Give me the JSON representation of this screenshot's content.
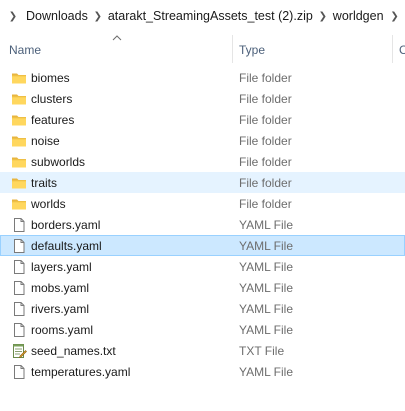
{
  "breadcrumb": {
    "items": [
      "Downloads",
      "atarakt_StreamingAssets_test (2).zip",
      "worldgen"
    ]
  },
  "columns": {
    "name": "Name",
    "type": "Type",
    "next": "C"
  },
  "files": [
    {
      "name": "biomes",
      "type": "File folder",
      "icon": "folder-icon",
      "state": "normal"
    },
    {
      "name": "clusters",
      "type": "File folder",
      "icon": "folder-icon",
      "state": "normal"
    },
    {
      "name": "features",
      "type": "File folder",
      "icon": "folder-icon",
      "state": "normal"
    },
    {
      "name": "noise",
      "type": "File folder",
      "icon": "folder-icon",
      "state": "normal"
    },
    {
      "name": "subworlds",
      "type": "File folder",
      "icon": "folder-icon",
      "state": "normal"
    },
    {
      "name": "traits",
      "type": "File folder",
      "icon": "folder-icon",
      "state": "hover"
    },
    {
      "name": "worlds",
      "type": "File folder",
      "icon": "folder-icon",
      "state": "normal"
    },
    {
      "name": "borders.yaml",
      "type": "YAML File",
      "icon": "document-icon",
      "state": "normal"
    },
    {
      "name": "defaults.yaml",
      "type": "YAML File",
      "icon": "document-icon",
      "state": "selected"
    },
    {
      "name": "layers.yaml",
      "type": "YAML File",
      "icon": "document-icon",
      "state": "normal"
    },
    {
      "name": "mobs.yaml",
      "type": "YAML File",
      "icon": "document-icon",
      "state": "normal"
    },
    {
      "name": "rivers.yaml",
      "type": "YAML File",
      "icon": "document-icon",
      "state": "normal"
    },
    {
      "name": "rooms.yaml",
      "type": "YAML File",
      "icon": "document-icon",
      "state": "normal"
    },
    {
      "name": "seed_names.txt",
      "type": "TXT File",
      "icon": "text-file-icon",
      "state": "normal"
    },
    {
      "name": "temperatures.yaml",
      "type": "YAML File",
      "icon": "document-icon",
      "state": "normal"
    }
  ],
  "colors": {
    "selected_bg": "#cce8ff",
    "selected_border": "#99d1ff",
    "hover_bg": "#e5f3ff",
    "folder_yellow": "#ffd75e",
    "header_text": "#4c607a"
  }
}
